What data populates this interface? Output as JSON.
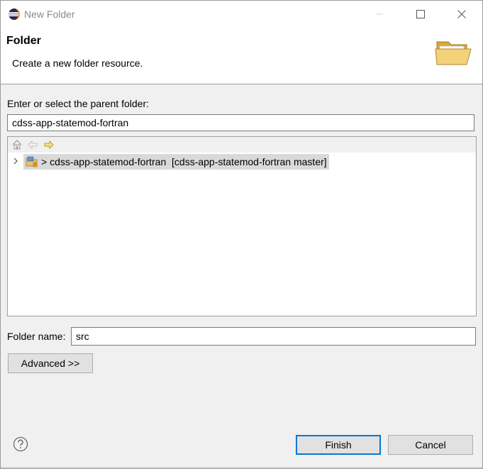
{
  "window": {
    "title": "New Folder"
  },
  "banner": {
    "title": "Folder",
    "description": "Create a new folder resource."
  },
  "parent": {
    "label": "Enter or select the parent folder:",
    "value": "cdss-app-statemod-fortran"
  },
  "tree": {
    "toolbar_icons": [
      "home-icon",
      "back-arrow-icon",
      "forward-arrow-icon"
    ],
    "items": [
      {
        "label": "> cdss-app-statemod-fortran  [cdss-app-statemod-fortran master]",
        "icon": "git-project-icon",
        "selected": true,
        "expanded": false
      }
    ]
  },
  "folder": {
    "label": "Folder name:",
    "value": "src"
  },
  "buttons": {
    "advanced": "Advanced >>",
    "finish": "Finish",
    "cancel": "Cancel"
  },
  "colors": {
    "accent": "#0078d7",
    "selection": "#d9d9d9",
    "folder": "#e8c56a"
  }
}
